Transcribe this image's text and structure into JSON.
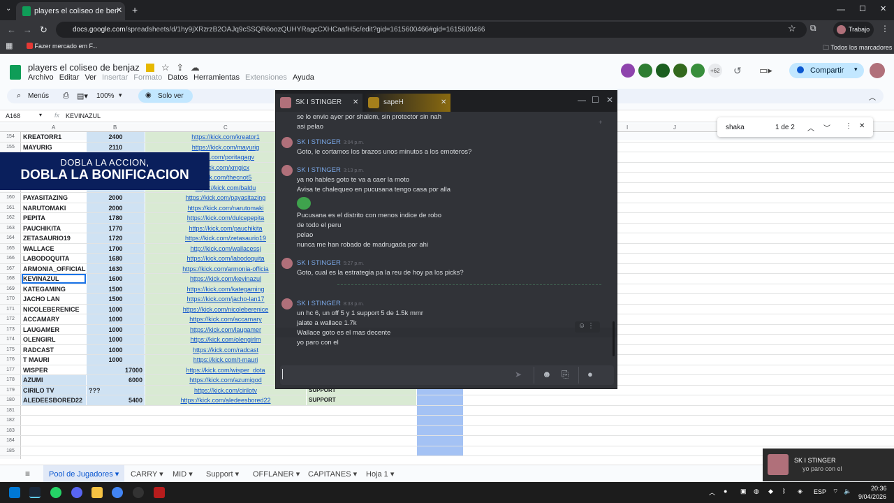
{
  "browser": {
    "tab_title": "players el coliseo de benjaz - H",
    "tab_close": "✕",
    "new_tab": "+",
    "url_domain": "docs.google.com",
    "url_path": "/spreadsheets/d/1hy9jXRzrzB2OAJq9cSSQR6oozQUHYRagcCXHCaafH5c/edit?gid=1615600466#gid=1615600466",
    "profile": "Trabajo",
    "bookmark1": "Fazer mercado em F...",
    "bookmarks_all": "Todos los marcadores"
  },
  "sheets": {
    "doc_title": "players el coliseo de benjaz",
    "menu": [
      "Archivo",
      "Editar",
      "Ver",
      "Insertar",
      "Formato",
      "Datos",
      "Herramientas",
      "Extensiones",
      "Ayuda"
    ],
    "share_label": "Compartir",
    "avatar_count": "+62",
    "toolbar_menus": "Menús",
    "zoom": "100%",
    "view_only": "Solo ver",
    "cell_ref": "A168",
    "formula": "KEVINAZUL",
    "col_headers": [
      "A",
      "B",
      "C",
      "I",
      "J"
    ],
    "find_query": "shaka",
    "find_count": "1 de 2",
    "promo_line1": "DOBLA LA ACCION,",
    "promo_line2": "DOBLA LA BONIFICACION",
    "rows": [
      {
        "n": "154",
        "a": "KREATORR1",
        "b": "2400",
        "c": "https://kick.com/kreator1",
        "d": ""
      },
      {
        "n": "155",
        "a": "MAYURIG",
        "b": "2110",
        "c": "https://kick.com/mayurig",
        "d": ""
      },
      {
        "n": "156",
        "a": "",
        "b": "",
        "c": "/kick.com/poritagagv",
        "d": ""
      },
      {
        "n": "157",
        "a": "",
        "b": "",
        "c": "/kick.com/xmgicx",
        "d": ""
      },
      {
        "n": "158",
        "a": "",
        "b": "",
        "c": "/kick.com/thecnot5",
        "d": ""
      },
      {
        "n": "159",
        "a": "BALDU",
        "b": "2000",
        "c": "https://kick.com/baldu",
        "d": ""
      },
      {
        "n": "160",
        "a": "PAYASITAZING",
        "b": "2000",
        "c": "https://kick.com/payasitazing",
        "d": ""
      },
      {
        "n": "161",
        "a": "NARUTOMAKI",
        "b": "2000",
        "c": "https://kick.com/narutomaki",
        "d": ""
      },
      {
        "n": "162",
        "a": "PEPITA",
        "b": "1780",
        "c": "https://kick.com/dulcepepita",
        "d": ""
      },
      {
        "n": "163",
        "a": "PAUCHIKITA",
        "b": "1770",
        "c": "https://kick.com/pauchikita",
        "d": ""
      },
      {
        "n": "164",
        "a": "ZETASAURIO19",
        "b": "1720",
        "c": "https://kick.com/zetasaurio19",
        "d": ""
      },
      {
        "n": "165",
        "a": "WALLACE",
        "b": "1700",
        "c": "http://kick.com/wallacessj",
        "d": ""
      },
      {
        "n": "166",
        "a": "LABODOQUITA",
        "b": "1680",
        "c": "https://kick.com/labodoquita",
        "d": ""
      },
      {
        "n": "167",
        "a": "ARMONIA_OFFICIAL",
        "b": "1630",
        "c": "https://kick.com/armonia-officia",
        "d": ""
      },
      {
        "n": "168",
        "a": "KEVINAZUL",
        "b": "1600",
        "c": "https://kick.com/kevinazul",
        "d": ""
      },
      {
        "n": "169",
        "a": "KATEGAMING",
        "b": "1500",
        "c": "https://kick.com/kategaming",
        "d": ""
      },
      {
        "n": "170",
        "a": "JACHO LAN",
        "b": "1500",
        "c": "https://kick.com/jacho-lan17",
        "d": ""
      },
      {
        "n": "171",
        "a": "NICOLEBERENICE",
        "b": "1000",
        "c": "https://kick.com/nicoleberenice",
        "d": ""
      },
      {
        "n": "172",
        "a": "ACCAMARY",
        "b": "1000",
        "c": "https://kick.com/accamary",
        "d": ""
      },
      {
        "n": "173",
        "a": "LAUGAMER",
        "b": "1000",
        "c": "https://kick.com/laugamer",
        "d": ""
      },
      {
        "n": "174",
        "a": "OLENGIRL",
        "b": "1000",
        "c": "https://kick.com/olengirlm",
        "d": ""
      },
      {
        "n": "175",
        "a": "RADCAST",
        "b": "1000",
        "c": "https://kick.com/radcast",
        "d": ""
      },
      {
        "n": "176",
        "a": "T MAURI",
        "b": "1000",
        "c": "https://kick.com/t-mauri",
        "d": ""
      },
      {
        "n": "177",
        "a": "WISPER",
        "b": "17000",
        "c": "https://kick.com/wisper_dota",
        "d": ""
      },
      {
        "n": "178",
        "a": "AZUMI",
        "b": "6000",
        "c": "https://kick.com/azumigod",
        "d": ""
      },
      {
        "n": "179",
        "a": "CIRILO TV",
        "b": "???",
        "c": "https://kick.com/cirilotv",
        "d": "SUPPORT"
      },
      {
        "n": "180",
        "a": "ALEDEESBORED22",
        "b": "5400",
        "c": "https://kick.com/aledeesbored22",
        "d": "SUPPORT"
      },
      {
        "n": "181",
        "a": "",
        "b": "",
        "c": "",
        "d": ""
      },
      {
        "n": "182",
        "a": "",
        "b": "",
        "c": "",
        "d": ""
      },
      {
        "n": "183",
        "a": "",
        "b": "",
        "c": "",
        "d": ""
      },
      {
        "n": "184",
        "a": "",
        "b": "",
        "c": "",
        "d": ""
      },
      {
        "n": "185",
        "a": "",
        "b": "",
        "c": "",
        "d": ""
      }
    ],
    "sheet_tabs": [
      "Pool de Jugadores",
      "CARRY",
      "MID",
      "Support",
      "OFFLANER",
      "CAPITANES",
      "Hoja 1"
    ]
  },
  "chat": {
    "tab1": "SK I STINGER",
    "tab2": "sapeH",
    "lines": [
      {
        "type": "msg",
        "text": "se lo envio ayer por shalom, sin protector sin nah"
      },
      {
        "type": "msg",
        "text": "asi pelao"
      },
      {
        "type": "author",
        "name": "SK I STINGER",
        "time": "3:04 p.m."
      },
      {
        "type": "msg",
        "text": "Goto, le cortamos los brazos unos minutos a los emoteros?"
      },
      {
        "type": "author",
        "name": "SK I STINGER",
        "time": "3:13 p.m."
      },
      {
        "type": "msg",
        "text": "ya no hables goto te va a caer la moto"
      },
      {
        "type": "msg",
        "text": "Avisa te chalequeo en pucusana tengo casa por alla"
      },
      {
        "type": "msg",
        "text": "Pucusana es el distrito con menos indice de robo"
      },
      {
        "type": "msg",
        "text": "de todo el peru"
      },
      {
        "type": "msg",
        "text": "pelao"
      },
      {
        "type": "msg",
        "text": "nunca me han robado de madrugada por ahi"
      },
      {
        "type": "author",
        "name": "SK I STINGER",
        "time": "5:27 p.m."
      },
      {
        "type": "msg",
        "text": "Goto, cual es la estrategia pa la reu de hoy pa los picks?"
      },
      {
        "type": "author",
        "name": "SK I STINGER",
        "time": "8:33 p.m."
      },
      {
        "type": "msg",
        "text": "un hc 6, un off 5 y 1 support 5 de 1.5k mmr"
      },
      {
        "type": "msg",
        "text": "jalate a wallace 1.7k"
      },
      {
        "type": "msg",
        "text": "Wallace goto es el mas decente"
      },
      {
        "type": "msg",
        "text": "yo paro con el"
      }
    ]
  },
  "toast": {
    "title": "SK I STINGER",
    "body": "yo paro con el"
  },
  "taskbar": {
    "time": "20:36",
    "date": "9/04/2026",
    "lang": "ESP"
  },
  "colors": {
    "accent": "#0b57d0",
    "link": "#1155cc",
    "chat_bg": "#313338",
    "author": "#7aa7e6"
  }
}
